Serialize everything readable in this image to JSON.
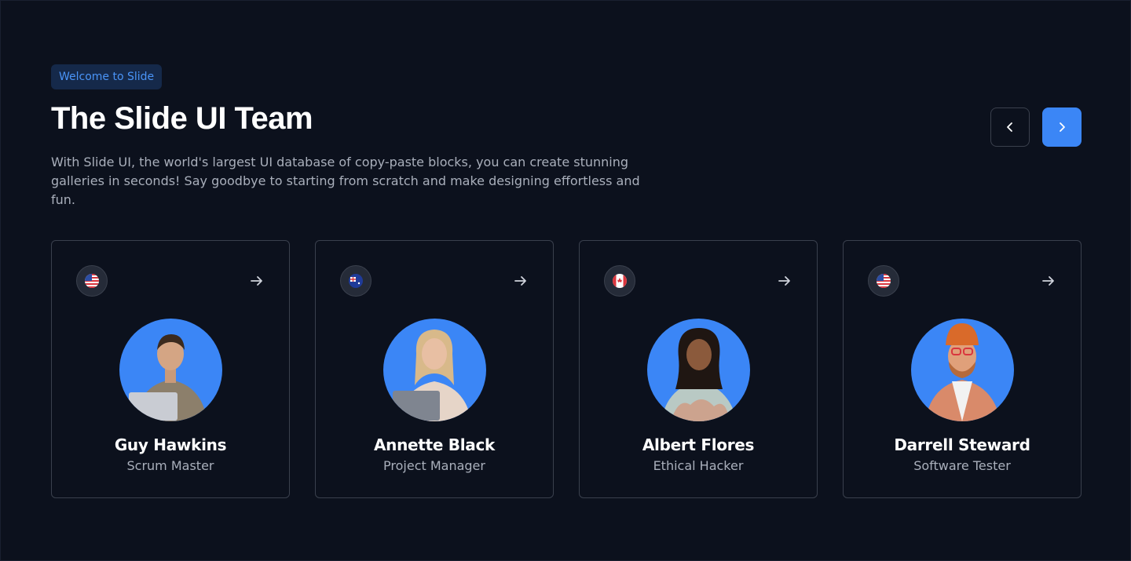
{
  "header": {
    "badge": "Welcome to Slide",
    "title": "The Slide UI Team",
    "description": "With Slide UI, the world's largest UI database of copy-paste blocks, you can create stunning galleries in seconds! Say goodbye to starting from scratch and make designing effortless and fun."
  },
  "navigation": {
    "prev_icon": "chevron-left-icon",
    "next_icon": "chevron-right-icon"
  },
  "colors": {
    "background": "#0c111d",
    "accent": "#3b86f6",
    "badge_bg": "#15294a",
    "badge_text": "#4a94f7",
    "muted_text": "#a9afbb",
    "border": "#3a404d"
  },
  "team": [
    {
      "name": "Guy Hawkins",
      "role": "Scrum Master",
      "flag": "us-flag-icon"
    },
    {
      "name": "Annette Black",
      "role": "Project Manager",
      "flag": "au-flag-icon"
    },
    {
      "name": "Albert Flores",
      "role": "Ethical Hacker",
      "flag": "ca-flag-icon"
    },
    {
      "name": "Darrell Steward",
      "role": "Software Tester",
      "flag": "us-flag-icon"
    }
  ]
}
